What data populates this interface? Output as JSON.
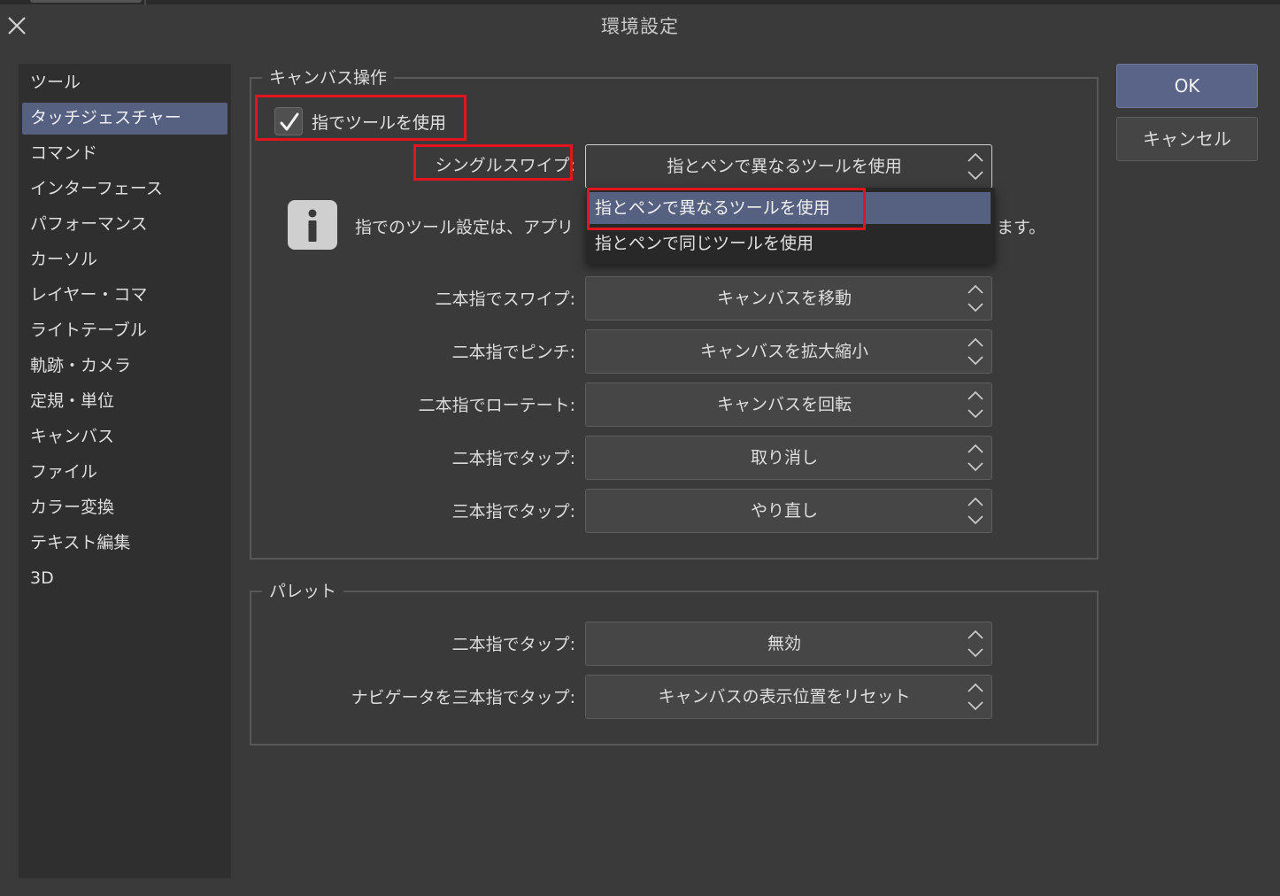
{
  "window": {
    "title": "環境設定"
  },
  "sidebar": {
    "items": [
      {
        "label": "ツール"
      },
      {
        "label": "タッチジェスチャー",
        "active": true
      },
      {
        "label": "コマンド"
      },
      {
        "label": "インターフェース"
      },
      {
        "label": "パフォーマンス"
      },
      {
        "label": "カーソル"
      },
      {
        "label": "レイヤー・コマ"
      },
      {
        "label": "ライトテーブル"
      },
      {
        "label": "軌跡・カメラ"
      },
      {
        "label": "定規・単位"
      },
      {
        "label": "キャンバス"
      },
      {
        "label": "ファイル"
      },
      {
        "label": "カラー変換"
      },
      {
        "label": "テキスト編集"
      },
      {
        "label": "3D"
      }
    ]
  },
  "canvas_group": {
    "legend": "キャンバス操作",
    "use_finger_checkbox": {
      "label": "指でツールを使用",
      "checked": true
    },
    "single_swipe": {
      "label": "シングルスワイプ:",
      "value": "指とペンで異なるツールを使用"
    },
    "info": {
      "text": "指でのツール設定は、アプリ",
      "text_tail": "ます。"
    },
    "dropdown_options": [
      {
        "label": "指とペンで異なるツールを使用",
        "selected": true
      },
      {
        "label": "指とペンで同じツールを使用",
        "selected": false
      }
    ],
    "rows": [
      {
        "label": "二本指でスワイプ:",
        "value": "キャンバスを移動"
      },
      {
        "label": "二本指でピンチ:",
        "value": "キャンバスを拡大縮小"
      },
      {
        "label": "二本指でローテート:",
        "value": "キャンバスを回転"
      },
      {
        "label": "二本指でタップ:",
        "value": "取り消し"
      },
      {
        "label": "三本指でタップ:",
        "value": "やり直し"
      }
    ]
  },
  "palette_group": {
    "legend": "パレット",
    "rows": [
      {
        "label": "二本指でタップ:",
        "value": "無効"
      },
      {
        "label": "ナビゲータを三本指でタップ:",
        "value": "キャンバスの表示位置をリセット"
      }
    ]
  },
  "buttons": {
    "ok": "OK",
    "cancel": "キャンセル"
  },
  "colors": {
    "accent": "#566080",
    "highlight": "#e2141e",
    "background": "#3a3a3a"
  }
}
